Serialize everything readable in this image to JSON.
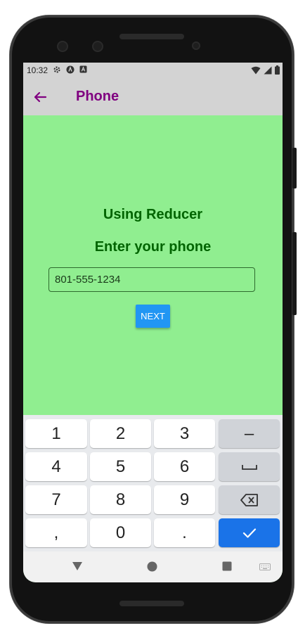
{
  "status_bar": {
    "time": "10:32",
    "left_icons": [
      "gear-icon",
      "app-icon",
      "a-badge-icon"
    ],
    "right_icons": [
      "wifi-icon",
      "signal-icon",
      "battery-icon"
    ]
  },
  "app_bar": {
    "back_icon": "back-arrow-icon",
    "title": "Phone",
    "title_color": "#800080",
    "background": "#d3d3d3"
  },
  "content": {
    "background": "#90ee90",
    "heading1": "Using Reducer",
    "heading2": "Enter your phone",
    "heading_color": "#006400",
    "phone_input": {
      "value": "801-555-1234",
      "placeholder": ""
    },
    "next_button": {
      "label": "NEXT",
      "color": "#2196f3"
    }
  },
  "keyboard": {
    "rows": [
      [
        "1",
        "2",
        "3",
        "–"
      ],
      [
        "4",
        "5",
        "6",
        "␣"
      ],
      [
        "7",
        "8",
        "9",
        "⌫"
      ],
      [
        ",",
        "0",
        ".",
        "✓"
      ]
    ],
    "action_color": "#1a73e8"
  },
  "nav_bar": {
    "items": [
      "back-triangle-icon",
      "home-circle-icon",
      "recents-square-icon",
      "keyboard-switch-icon"
    ]
  }
}
